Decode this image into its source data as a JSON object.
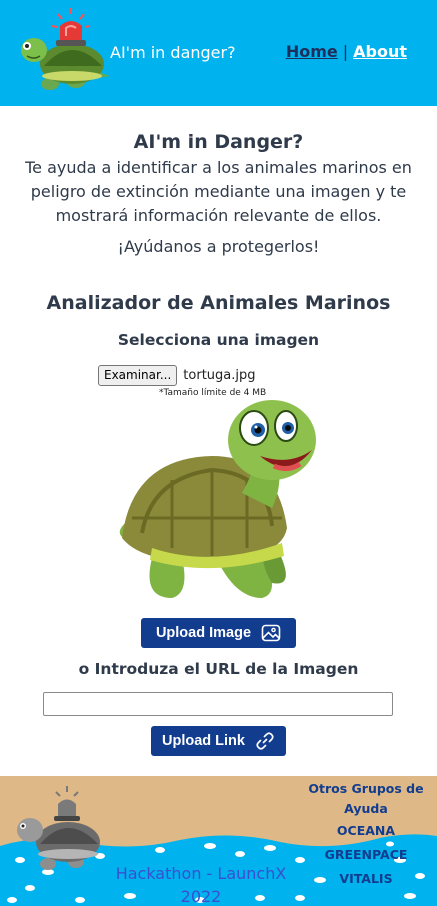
{
  "header": {
    "brand": "AI'm in danger?",
    "nav": {
      "home": "Home",
      "separator": "|",
      "about": "About"
    }
  },
  "intro": {
    "title": "AI'm in Danger?",
    "description": "Te ayuda a identificar a los animales marinos en peligro de extinción mediante una imagen y te mostrará información relevante de ellos.",
    "call_to_action": "¡Ayúdanos a protegerlos!"
  },
  "analyzer": {
    "title": "Analizador de Animales Marinos",
    "select_label": "Selecciona una imagen",
    "browse_label": "Examinar...",
    "file_name": "tortuga.jpg",
    "size_note": "*Tamaño límite de 4 MB",
    "upload_image_label": "Upload Image",
    "url_label": "o Introduza el URL de la Imagen",
    "url_value": "",
    "upload_link_label": "Upload Link"
  },
  "footer": {
    "credit": "Hackathon - LaunchX 2022",
    "groups_title": "Otros Grupos de Ayuda",
    "groups": [
      "OCEANA",
      "GREENPACE",
      "VITALIS"
    ]
  },
  "colors": {
    "header_bg": "#00b2ee",
    "button_bg": "#123d8f",
    "footer_sand": "#deb887",
    "footer_sea": "#00b2ee",
    "text": "#2f3a4a"
  },
  "icons": [
    "alarm-turtle-logo-icon",
    "image-icon",
    "link-icon"
  ]
}
